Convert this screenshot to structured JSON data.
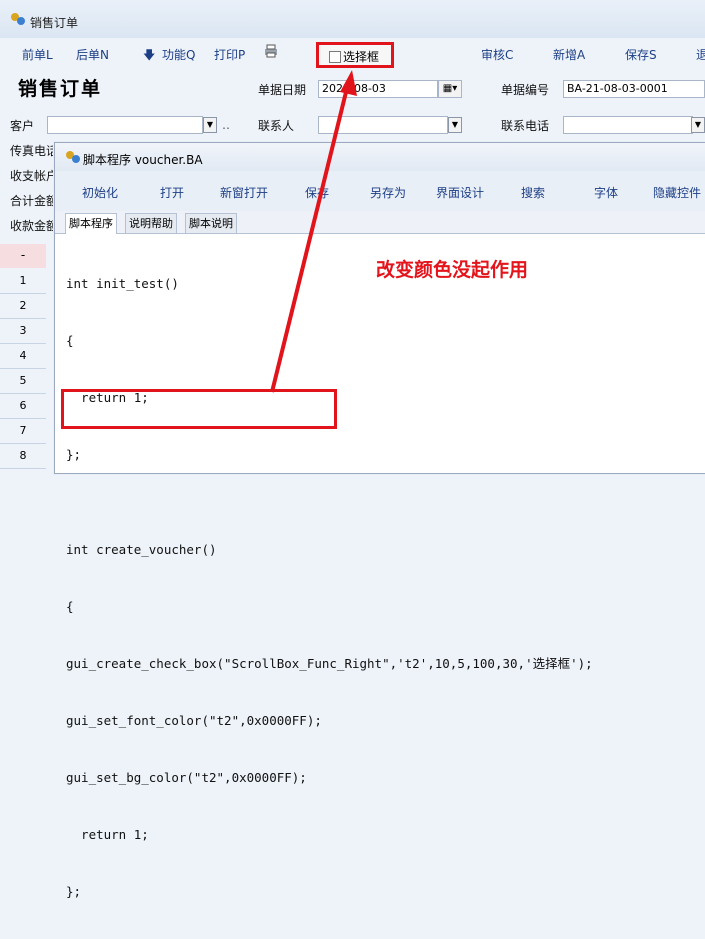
{
  "main_window": {
    "title": "销售订单",
    "toolbar": {
      "prev": "前单L",
      "next": "后单N",
      "func": "功能Q",
      "print": "打印P",
      "checkbox": "选择框",
      "audit": "审核C",
      "add": "新增A",
      "save": "保存S",
      "more": "退"
    },
    "form_title": "销售订单",
    "fields": {
      "date_label": "单据日期",
      "date_value": "2021-08-03",
      "number_label": "单据编号",
      "number_value": "BA-21-08-03-0001",
      "customer_label": "客户",
      "contact_label": "联系人",
      "phone_label": "联系电话",
      "fax_label": "传真电话",
      "account_label": "收支帐户",
      "total_label": "合计金额",
      "received_label": "收款金额"
    },
    "grid": {
      "header": "-",
      "rows": [
        "1",
        "2",
        "3",
        "4",
        "5",
        "6",
        "7",
        "8"
      ]
    }
  },
  "script_window": {
    "title": "脚本程序 voucher.BA",
    "toolbar": [
      "初始化",
      "打开",
      "新窗打开",
      "保存",
      "另存为",
      "界面设计",
      "搜索",
      "字体",
      "隐藏控件"
    ],
    "tabs": [
      "脚本程序",
      "说明帮助",
      "脚本说明"
    ],
    "code_lines": [
      "int init_test()",
      "{",
      "  return 1;",
      "};",
      "",
      "int create_voucher()",
      "{",
      "gui_create_check_box(\"ScrollBox_Func_Right\",'t2',10,5,100,30,'选择框');",
      "gui_set_font_color(\"t2\",0x0000FF);",
      "gui_set_bg_color(\"t2\",0x0000FF);",
      "  return 1;",
      "};"
    ]
  },
  "annotation": "改变颜色没起作用",
  "colors": {
    "annotation": "#e3141b",
    "toolbar_text": "#1d3f86"
  }
}
